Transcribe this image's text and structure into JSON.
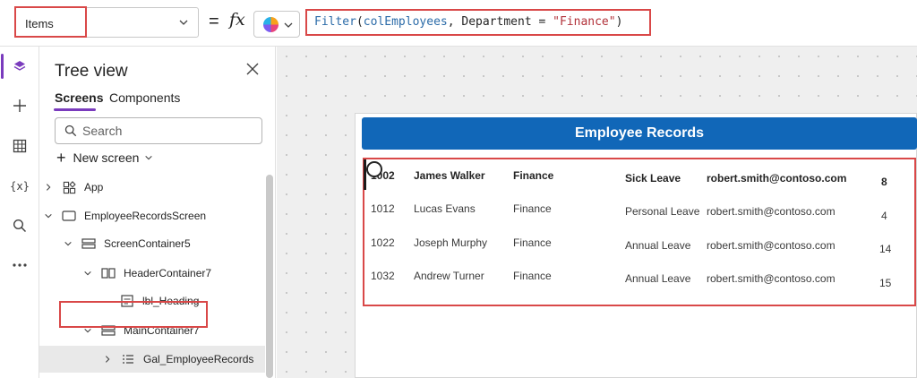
{
  "formula_bar": {
    "property": "Items",
    "formula": {
      "fn": "Filter",
      "open": "(",
      "arg1": "colEmployees",
      "sep": ", ",
      "arg2": "Department",
      "op": " = ",
      "str": "\"Finance\"",
      "close": ")"
    },
    "equals": "=",
    "fx": "fx"
  },
  "tree": {
    "title": "Tree view",
    "tabs": [
      "Screens",
      "Components"
    ],
    "search_placeholder": "Search",
    "new_screen": "New screen",
    "nodes": [
      {
        "label": "App"
      },
      {
        "label": "EmployeeRecordsScreen"
      },
      {
        "label": "ScreenContainer5"
      },
      {
        "label": "HeaderContainer7"
      },
      {
        "label": "lbl_Heading"
      },
      {
        "label": "MainContainer7"
      },
      {
        "label": "Gal_EmployeeRecords"
      }
    ]
  },
  "canvas": {
    "heading": "Employee Records",
    "rows": [
      {
        "id": "1002",
        "name": "James Walker",
        "dept": "Finance",
        "leave": "Sick Leave",
        "email": "robert.smith@contoso.com",
        "days": "8"
      },
      {
        "id": "1012",
        "name": "Lucas Evans",
        "dept": "Finance",
        "leave": "Personal Leave",
        "email": "robert.smith@contoso.com",
        "days": "4"
      },
      {
        "id": "1022",
        "name": "Joseph Murphy",
        "dept": "Finance",
        "leave": "Annual Leave",
        "email": "robert.smith@contoso.com",
        "days": "14"
      },
      {
        "id": "1032",
        "name": "Andrew Turner",
        "dept": "Finance",
        "leave": "Annual Leave",
        "email": "robert.smith@contoso.com",
        "days": "15"
      }
    ]
  },
  "colors": {
    "accent": "#7a3bbd",
    "header_blue": "#1167b8",
    "highlight_red": "#d94848"
  }
}
